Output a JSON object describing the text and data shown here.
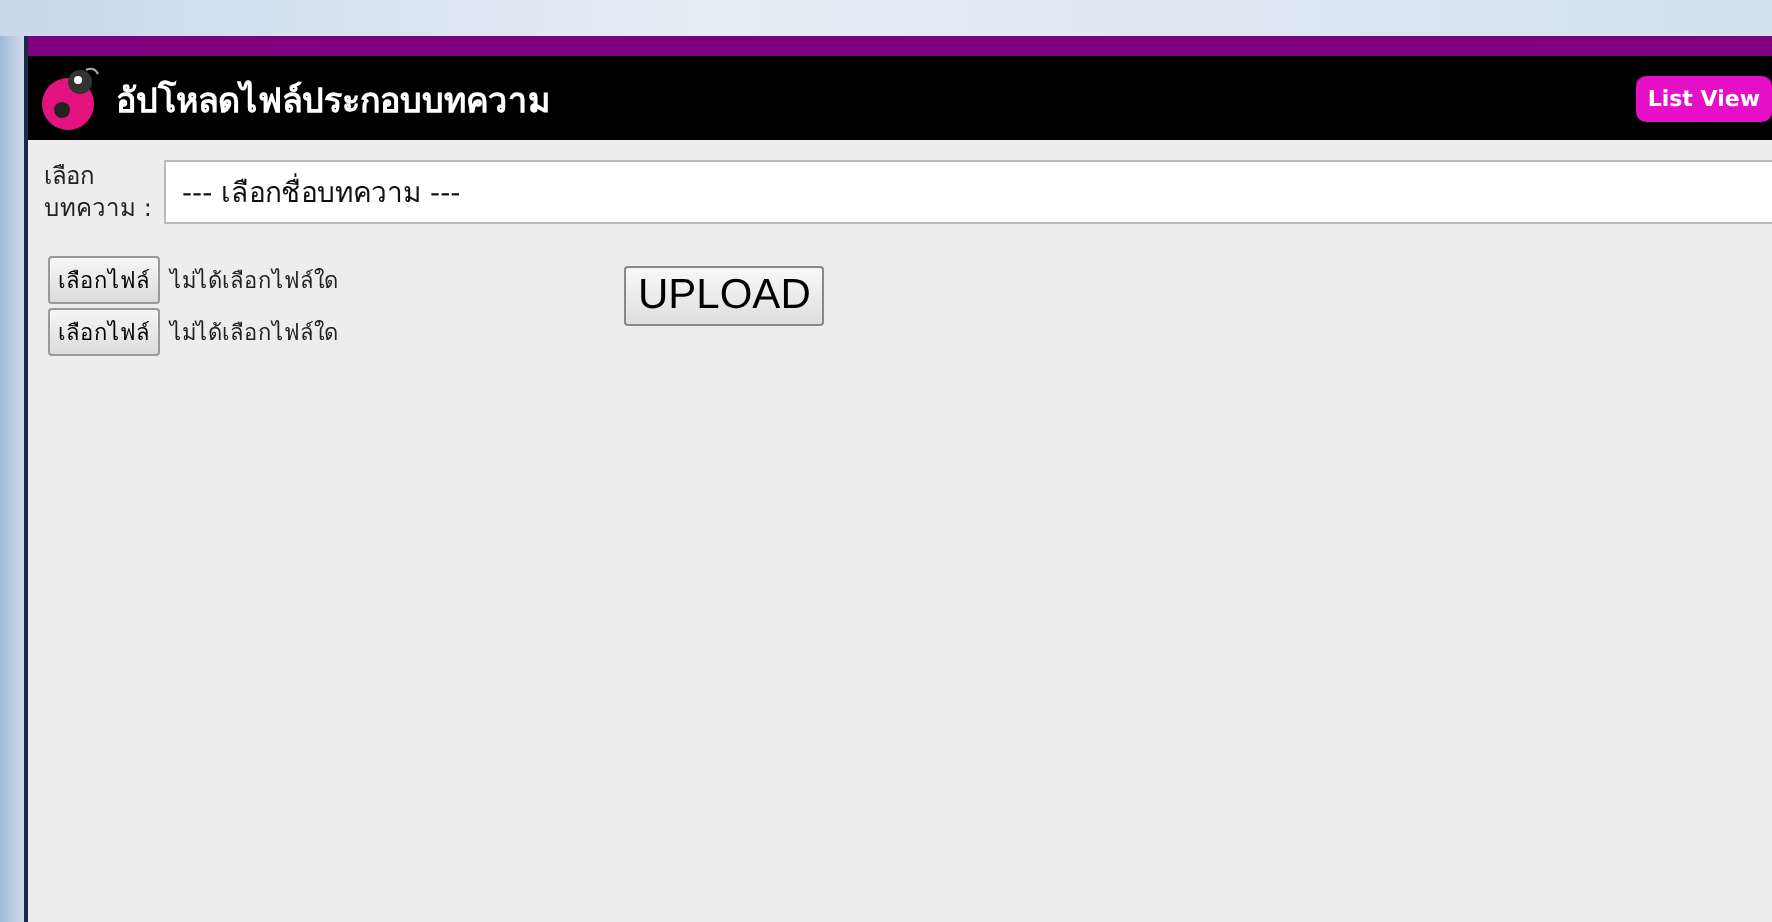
{
  "header": {
    "title": "อัปโหลดไฟล์ประกอบบทความ",
    "button": "List View"
  },
  "form": {
    "label": "เลือก บทความ :",
    "select_value": "--- เลือกชื่อบทความ ---",
    "files": [
      {
        "button": "เลือกไฟล์",
        "status": "ไม่ได้เลือกไฟล์ใด"
      },
      {
        "button": "เลือกไฟล์",
        "status": "ไม่ได้เลือกไฟล์ใด"
      }
    ],
    "upload": "UPLOAD"
  }
}
